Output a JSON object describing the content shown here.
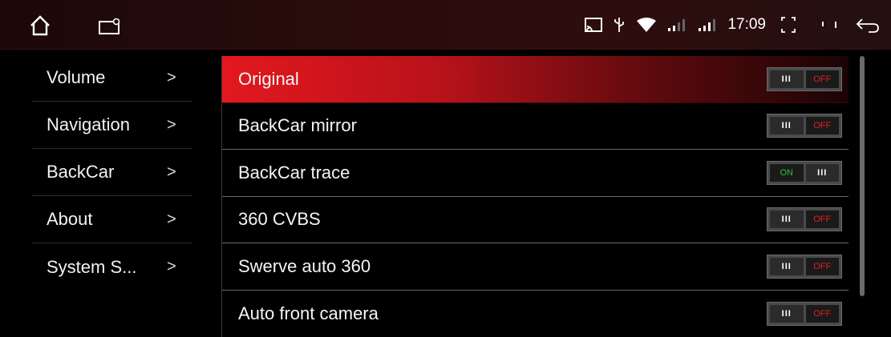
{
  "status_bar": {
    "time": "17:09",
    "icons": [
      "home-icon",
      "tv-icon",
      "cast-icon",
      "usb-icon",
      "wifi-icon",
      "signal-icon",
      "signal-icon",
      "screenshot-icon",
      "volume-icon",
      "back-icon"
    ]
  },
  "sidebar": {
    "items": [
      {
        "label": "Volume",
        "chevron": ">"
      },
      {
        "label": "Navigation",
        "chevron": ">"
      },
      {
        "label": "BackCar",
        "chevron": ">"
      },
      {
        "label": "About",
        "chevron": ">"
      },
      {
        "label": "System S...",
        "chevron": ">"
      }
    ]
  },
  "main": {
    "rows": [
      {
        "label": "Original",
        "state": "OFF"
      },
      {
        "label": "BackCar mirror",
        "state": "OFF"
      },
      {
        "label": "BackCar trace",
        "state": "ON"
      },
      {
        "label": "360 CVBS",
        "state": "OFF"
      },
      {
        "label": "Swerve auto 360",
        "state": "OFF"
      },
      {
        "label": "Auto front camera",
        "state": "OFF"
      }
    ]
  },
  "toggle": {
    "grip": "III"
  },
  "colors": {
    "accent": "#e3181e",
    "on": "#2fbf3a",
    "off": "#e02020"
  }
}
